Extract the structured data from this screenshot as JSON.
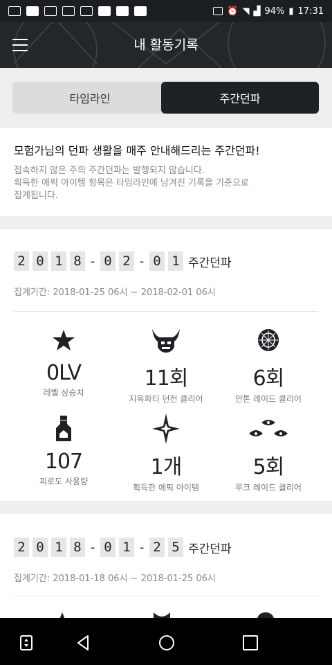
{
  "status_bar": {
    "battery": "94%",
    "time": "17:31"
  },
  "app_bar": {
    "title": "내 활동기록"
  },
  "tabs": [
    {
      "label": "타임라인"
    },
    {
      "label": "주간던파"
    }
  ],
  "intro": {
    "title": "모험가님의 던파 생활을 매주 안내해드리는 주간던파!",
    "line1": "접속하지 않은 주의 주간던파는 발행되지 않습니다.",
    "line2": "획득한 에픽 아이템 항목은 타임라인에 남겨진 기록을 기준으로",
    "line3": "집계됩니다."
  },
  "weeks": [
    {
      "date_chars": [
        "2",
        "0",
        "1",
        "8",
        "-",
        "0",
        "2",
        "-",
        "0",
        "1"
      ],
      "label": "주간던파",
      "period": "집계기간: 2018-01-25 06시 ~ 2018-02-01 06시",
      "stats": [
        {
          "icon": "star-icon",
          "value": "0LV",
          "label": "레벨 상승치"
        },
        {
          "icon": "demon-horned-icon",
          "value": "11회",
          "label": "지옥파티 던전 클리어"
        },
        {
          "icon": "anton-shell-icon",
          "value": "6회",
          "label": "안톤 레이드 클리어"
        },
        {
          "icon": "potion-bottle-icon",
          "value": "107",
          "label": "피로도 사용량"
        },
        {
          "icon": "sparkle-icon",
          "value": "1개",
          "label": "획득한 에픽 아이템"
        },
        {
          "icon": "luke-eyes-icon",
          "value": "5회",
          "label": "루크 레이드 클리어"
        }
      ]
    },
    {
      "date_chars": [
        "2",
        "0",
        "1",
        "8",
        "-",
        "0",
        "1",
        "-",
        "2",
        "5"
      ],
      "label": "주간던파",
      "period": "집계기간: 2018-01-18 06시 ~ 2018-01-25 06시"
    }
  ]
}
